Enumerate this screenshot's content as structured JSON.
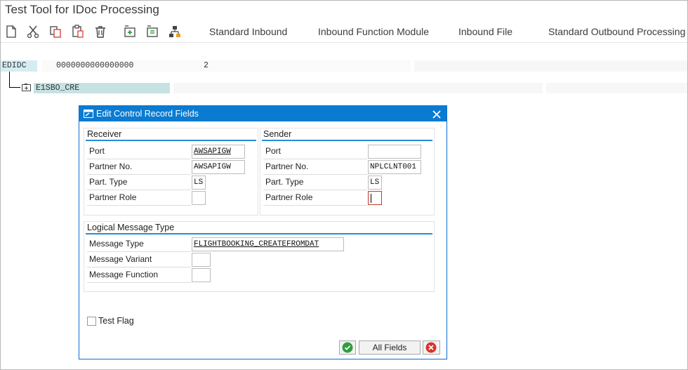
{
  "window": {
    "title": "Test Tool for IDoc Processing"
  },
  "toolbar": {
    "icons": [
      "new-document-icon",
      "cut-icon",
      "copy-icon",
      "paste-icon",
      "delete-icon",
      "insert-segment-icon",
      "edit-segment-icon",
      "hierarchy-icon"
    ],
    "buttons": [
      "Standard Inbound",
      "Inbound Function Module",
      "Inbound File",
      "Standard Outbound Processing"
    ]
  },
  "tree": {
    "root_label": "EDIDC",
    "doc_number": "0000000000000000",
    "count": "2",
    "segment": "E1SBO_CRE"
  },
  "dialog": {
    "title": "Edit Control Record Fields",
    "receiver": {
      "heading": "Receiver",
      "port_label": "Port",
      "port_value": "AWSAPIGW",
      "partner_no_label": "Partner No.",
      "partner_no_value": "AWSAPIGW",
      "part_type_label": "Part. Type",
      "part_type_value": "LS",
      "partner_role_label": "Partner Role",
      "partner_role_value": ""
    },
    "sender": {
      "heading": "Sender",
      "port_label": "Port",
      "port_value": "",
      "partner_no_label": "Partner No.",
      "partner_no_value": "NPLCLNT001",
      "part_type_label": "Part. Type",
      "part_type_value": "LS",
      "partner_role_label": "Partner Role",
      "partner_role_value": ""
    },
    "logical": {
      "heading": "Logical Message Type",
      "msg_type_label": "Message Type",
      "msg_type_value": "FLIGHTBOOKING_CREATEFROMDAT",
      "msg_variant_label": "Message Variant",
      "msg_variant_value": "",
      "msg_function_label": "Message Function",
      "msg_function_value": ""
    },
    "test_flag_label": "Test Flag",
    "all_fields_label": "All Fields"
  },
  "colors": {
    "accent": "#0a7bd1",
    "confirm": "#2e9e3f",
    "cancel": "#d9332b"
  }
}
